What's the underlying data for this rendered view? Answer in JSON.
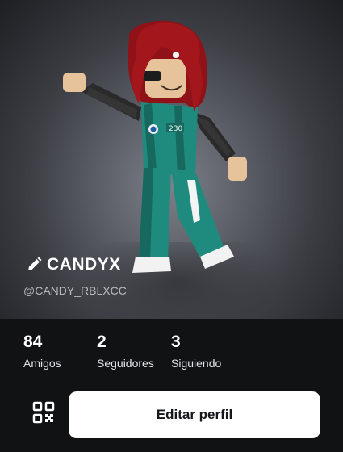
{
  "profile": {
    "display_name": "CANDYX",
    "username": "@CANDY_RBLXCC",
    "avatar": {
      "hair_color": "#a3161b",
      "outfit_color": "#1f8a7e",
      "outfit_number": "230",
      "skin_color": "#e6c39a"
    }
  },
  "stats": [
    {
      "count": "84",
      "label": "Amigos"
    },
    {
      "count": "2",
      "label": "Seguidores"
    },
    {
      "count": "3",
      "label": "Siguiendo"
    }
  ],
  "actions": {
    "edit_profile_label": "Editar perfil",
    "qr_icon": "qr-code-icon",
    "edit_name_icon": "pencil-icon"
  },
  "colors": {
    "background": "#111214",
    "button_bg": "#ffffff",
    "button_text": "#16171a",
    "secondary_text": "#b9bbc0"
  }
}
